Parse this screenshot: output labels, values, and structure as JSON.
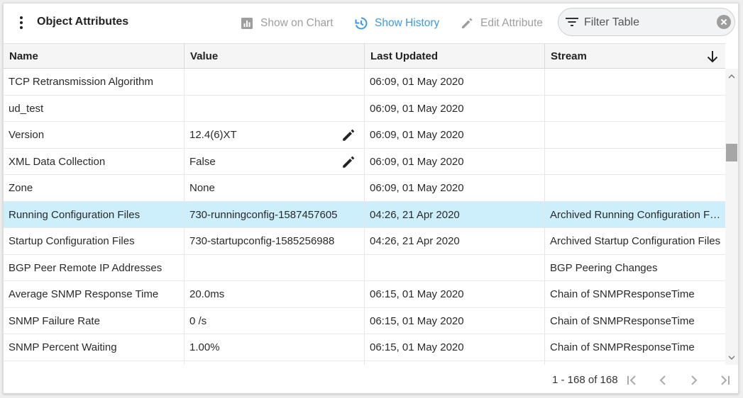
{
  "toolbar": {
    "title": "Object Attributes",
    "show_on_chart": "Show on Chart",
    "show_history": "Show History",
    "edit_attribute": "Edit Attribute",
    "filter_placeholder": "Filter Table"
  },
  "table": {
    "columns": [
      "Name",
      "Value",
      "Last Updated",
      "Stream"
    ],
    "rows": [
      {
        "name": "TCP Retransmission Algorithm",
        "value": "",
        "updated": "06:09, 01 May 2020",
        "stream": ""
      },
      {
        "name": "ud_test",
        "value": "",
        "updated": "06:09, 01 May 2020",
        "stream": ""
      },
      {
        "name": "Version",
        "value": "12.4(6)XT",
        "updated": "06:09, 01 May 2020",
        "stream": ""
      },
      {
        "name": "XML Data Collection",
        "value": "False",
        "updated": "06:09, 01 May 2020",
        "stream": ""
      },
      {
        "name": "Zone",
        "value": "None",
        "updated": "06:09, 01 May 2020",
        "stream": ""
      },
      {
        "name": "Running Configuration Files",
        "value": "730-runningconfig-1587457605",
        "updated": "04:26, 21 Apr 2020",
        "stream": "Archived Running Configuration Files"
      },
      {
        "name": "Startup Configuration Files",
        "value": "730-startupconfig-1585256988",
        "updated": "04:26, 21 Apr 2020",
        "stream": "Archived Startup Configuration Files"
      },
      {
        "name": "BGP Peer Remote IP Addresses",
        "value": "",
        "updated": "",
        "stream": "BGP Peering Changes"
      },
      {
        "name": "Average SNMP Response Time",
        "value": "20.0ms",
        "updated": "06:15, 01 May 2020",
        "stream": "Chain of SNMPResponseTime"
      },
      {
        "name": "SNMP Failure Rate",
        "value": "0 /s",
        "updated": "06:15, 01 May 2020",
        "stream": "Chain of SNMPResponseTime"
      },
      {
        "name": "SNMP Percent Waiting",
        "value": "1.00%",
        "updated": "06:15, 01 May 2020",
        "stream": "Chain of SNMPResponseTime"
      },
      {
        "name": "",
        "value": "",
        "updated": "",
        "stream": ""
      }
    ]
  },
  "pagination": {
    "info": "1 - 168 of 168"
  },
  "colors": {
    "accent": "#3d9ae0",
    "selected_row": "#cdeefb",
    "disabled": "#9e9e9e"
  }
}
